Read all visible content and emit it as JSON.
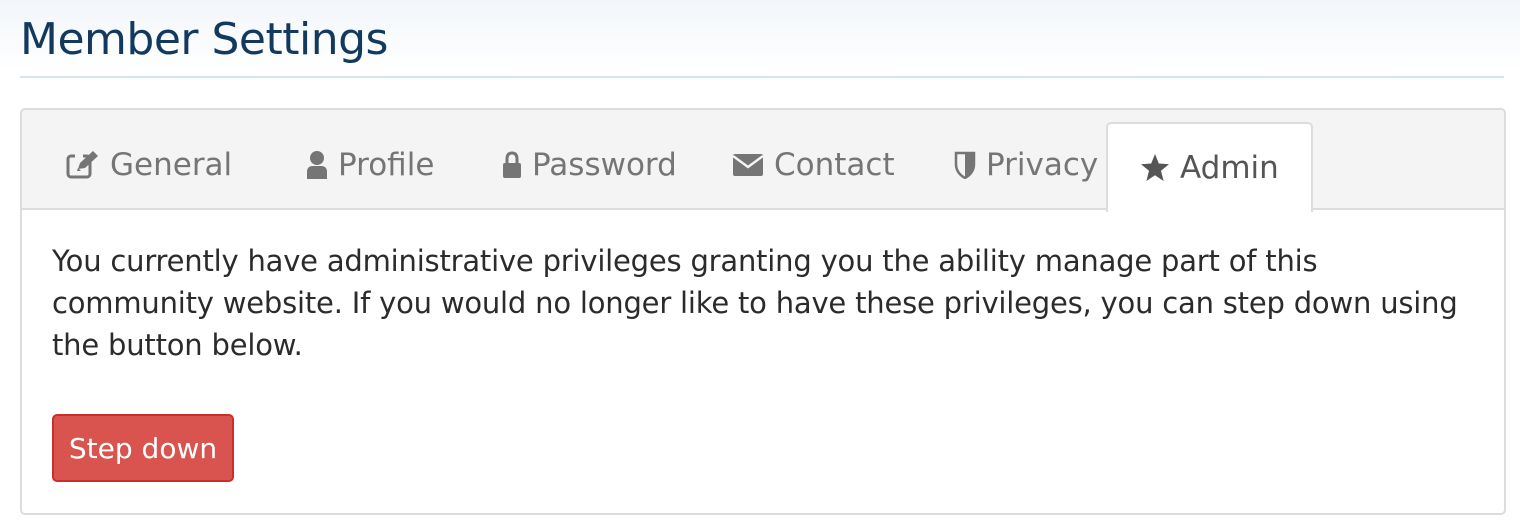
{
  "page": {
    "title": "Member Settings"
  },
  "tabs": [
    {
      "label": "General",
      "icon": "edit-icon"
    },
    {
      "label": "Profile",
      "icon": "user-icon"
    },
    {
      "label": "Password",
      "icon": "lock-icon"
    },
    {
      "label": "Contact",
      "icon": "envelope-icon"
    },
    {
      "label": "Privacy",
      "icon": "shield-icon"
    },
    {
      "label": "Admin",
      "icon": "star-icon",
      "active": true
    }
  ],
  "admin": {
    "description": "You currently have administrative privileges granting you the ability manage part of this community website. If you would no longer like to have these privileges, you can step down using the button below.",
    "step_down_label": "Step down"
  },
  "colors": {
    "title": "#133a5e",
    "danger": "#d9534f",
    "tab_text": "#757575",
    "active_tab_text": "#555555"
  }
}
